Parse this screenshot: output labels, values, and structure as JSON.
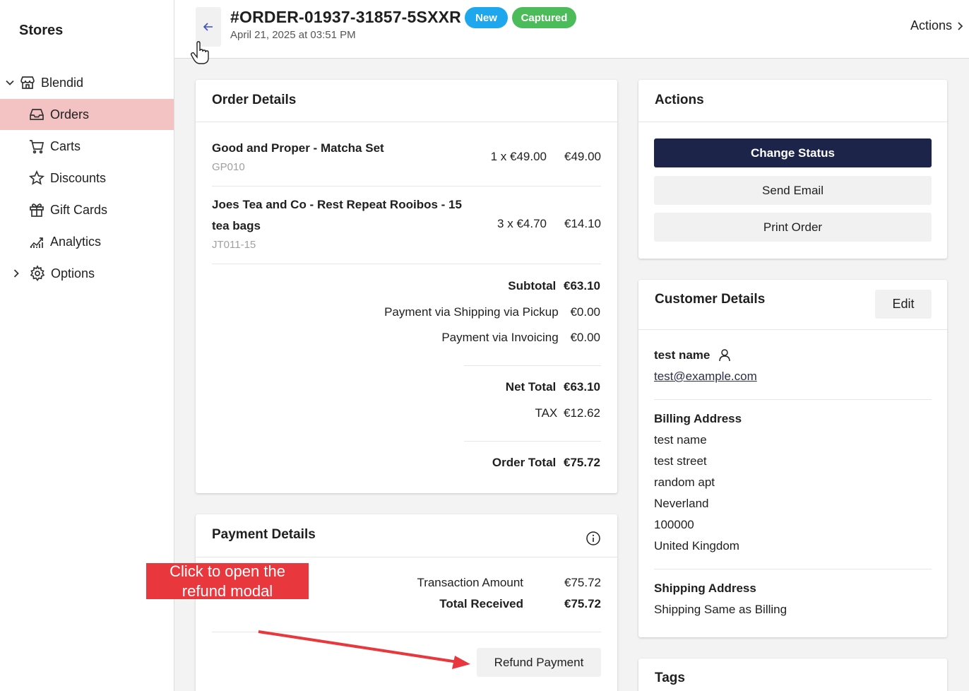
{
  "sidebar": {
    "title": "Stores",
    "store": "Blendid",
    "items": [
      {
        "label": "Orders",
        "icon": "inbox-icon",
        "active": true
      },
      {
        "label": "Carts",
        "icon": "cart-icon"
      },
      {
        "label": "Discounts",
        "icon": "star-icon"
      },
      {
        "label": "Gift Cards",
        "icon": "gift-icon"
      },
      {
        "label": "Analytics",
        "icon": "analytics-icon"
      }
    ],
    "options": "Options"
  },
  "header": {
    "order_id": "#ORDER-01937-31857-5SXXR",
    "date": "April 21, 2025 at 03:51 PM",
    "badge_new": "New",
    "badge_captured": "Captured",
    "actions": "Actions"
  },
  "order_details": {
    "title": "Order Details",
    "items": [
      {
        "name": "Good and Proper - Matcha Set",
        "sku": "GP010",
        "qty": "1 x €49.00",
        "total": "€49.00"
      },
      {
        "name": "Joes Tea and Co - Rest Repeat Rooibos - 15 tea bags",
        "sku": "JT011-15",
        "qty": "3 x €4.70",
        "total": "€14.10"
      }
    ],
    "subtotal_label": "Subtotal",
    "subtotal": "€63.10",
    "shipping_label": "Payment via Shipping via Pickup",
    "shipping": "€0.00",
    "invoicing_label": "Payment via Invoicing",
    "invoicing": "€0.00",
    "net_label": "Net Total",
    "net": "€63.10",
    "tax_label": "TAX",
    "tax": "€12.62",
    "order_total_label": "Order Total",
    "order_total": "€75.72"
  },
  "payment_details": {
    "title": "Payment Details",
    "transaction_label": "Transaction Amount",
    "transaction": "€75.72",
    "received_label": "Total Received",
    "received": "€75.72",
    "refund_button": "Refund Payment"
  },
  "actions": {
    "title": "Actions",
    "change_status": "Change Status",
    "send_email": "Send Email",
    "print_order": "Print Order"
  },
  "customer": {
    "title": "Customer Details",
    "edit": "Edit",
    "name": "test name",
    "email": "test@example.com",
    "billing_title": "Billing Address",
    "billing": [
      "test name",
      "test street",
      "random apt",
      "Neverland",
      "100000",
      "United Kingdom"
    ],
    "shipping_title": "Shipping Address",
    "shipping": "Shipping Same as Billing"
  },
  "tags": {
    "title": "Tags"
  },
  "callout": "Click to open the refund modal",
  "colors": {
    "primary": "#1c2449",
    "new": "#1fa7ee",
    "captured": "#4cbc5b",
    "active_nav": "#f3c3c3",
    "callout": "#e8383d"
  }
}
